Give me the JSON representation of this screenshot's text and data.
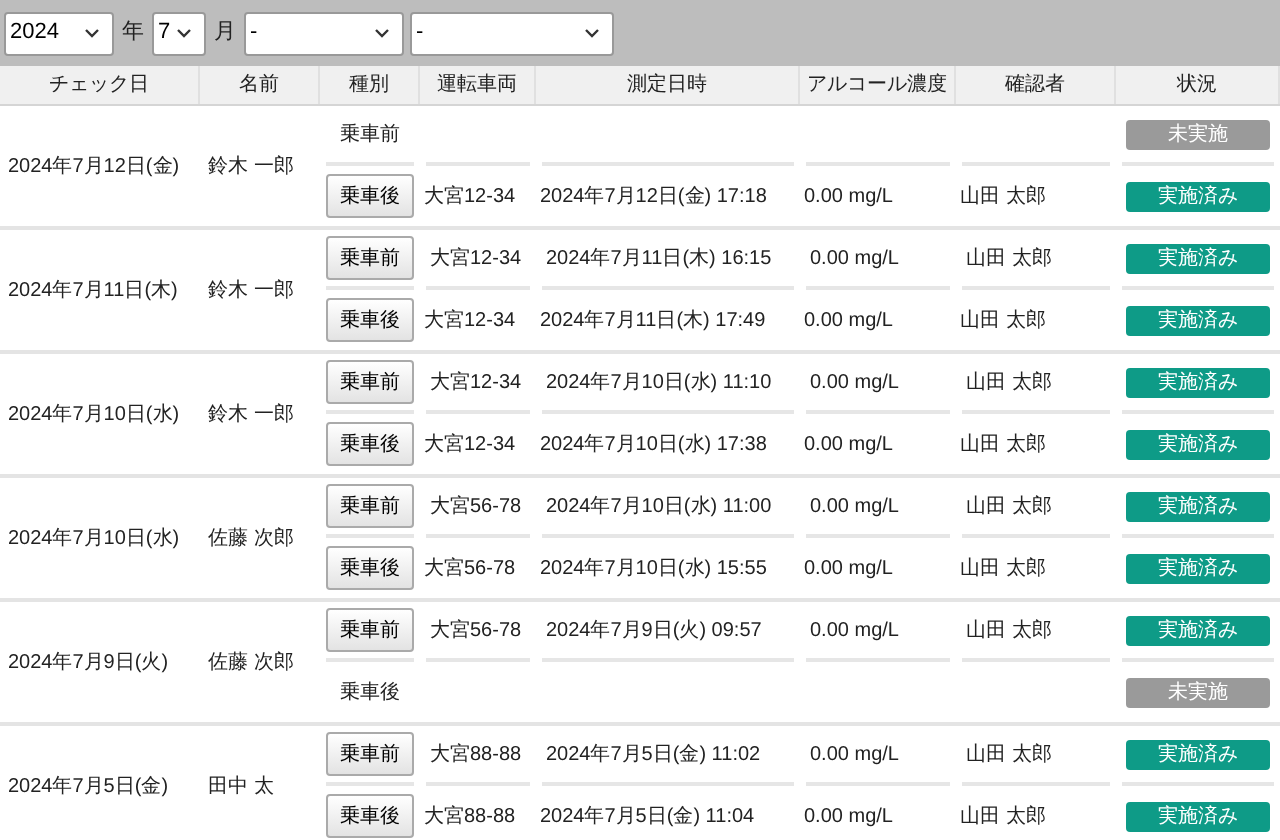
{
  "filters": {
    "year": "2024",
    "year_label": "年",
    "month": "7",
    "month_label": "月",
    "select_3": "-",
    "select_4": "-"
  },
  "table": {
    "columns": [
      "チェック日",
      "名前",
      "種別",
      "運転車両",
      "測定日時",
      "アルコール濃度",
      "確認者",
      "状況"
    ],
    "groups": [
      {
        "date": "2024年7月12日(金)",
        "name": "鈴木 一郎",
        "checks": [
          {
            "type": "乗車前",
            "done": false,
            "status": "未実施"
          },
          {
            "type": "乗車後",
            "done": true,
            "vehicle": "大宮12-34",
            "datetime": "2024年7月12日(金) 17:18",
            "alcohol": "0.00 mg/L",
            "checker": "山田 太郎",
            "status": "実施済み"
          }
        ]
      },
      {
        "date": "2024年7月11日(木)",
        "name": "鈴木 一郎",
        "checks": [
          {
            "type": "乗車前",
            "done": true,
            "vehicle": "大宮12-34",
            "datetime": "2024年7月11日(木) 16:15",
            "alcohol": "0.00 mg/L",
            "checker": "山田 太郎",
            "status": "実施済み"
          },
          {
            "type": "乗車後",
            "done": true,
            "vehicle": "大宮12-34",
            "datetime": "2024年7月11日(木) 17:49",
            "alcohol": "0.00 mg/L",
            "checker": "山田 太郎",
            "status": "実施済み"
          }
        ]
      },
      {
        "date": "2024年7月10日(水)",
        "name": "鈴木 一郎",
        "checks": [
          {
            "type": "乗車前",
            "done": true,
            "vehicle": "大宮12-34",
            "datetime": "2024年7月10日(水) 11:10",
            "alcohol": "0.00 mg/L",
            "checker": "山田 太郎",
            "status": "実施済み"
          },
          {
            "type": "乗車後",
            "done": true,
            "vehicle": "大宮12-34",
            "datetime": "2024年7月10日(水) 17:38",
            "alcohol": "0.00 mg/L",
            "checker": "山田 太郎",
            "status": "実施済み"
          }
        ]
      },
      {
        "date": "2024年7月10日(水)",
        "name": "佐藤 次郎",
        "checks": [
          {
            "type": "乗車前",
            "done": true,
            "vehicle": "大宮56-78",
            "datetime": "2024年7月10日(水) 11:00",
            "alcohol": "0.00 mg/L",
            "checker": "山田 太郎",
            "status": "実施済み"
          },
          {
            "type": "乗車後",
            "done": true,
            "vehicle": "大宮56-78",
            "datetime": "2024年7月10日(水) 15:55",
            "alcohol": "0.00 mg/L",
            "checker": "山田 太郎",
            "status": "実施済み"
          }
        ]
      },
      {
        "date": "2024年7月9日(火)",
        "name": "佐藤 次郎",
        "checks": [
          {
            "type": "乗車前",
            "done": true,
            "vehicle": "大宮56-78",
            "datetime": "2024年7月9日(火) 09:57",
            "alcohol": "0.00 mg/L",
            "checker": "山田 太郎",
            "status": "実施済み"
          },
          {
            "type": "乗車後",
            "done": false,
            "status": "未実施"
          }
        ]
      },
      {
        "date": "2024年7月5日(金)",
        "name": "田中 太",
        "checks": [
          {
            "type": "乗車前",
            "done": true,
            "vehicle": "大宮88-88",
            "datetime": "2024年7月5日(金) 11:02",
            "alcohol": "0.00 mg/L",
            "checker": "山田 太郎",
            "status": "実施済み"
          },
          {
            "type": "乗車後",
            "done": true,
            "vehicle": "大宮88-88",
            "datetime": "2024年7月5日(金) 11:04",
            "alcohol": "0.00 mg/L",
            "checker": "山田 太郎",
            "status": "実施済み"
          }
        ]
      }
    ]
  }
}
